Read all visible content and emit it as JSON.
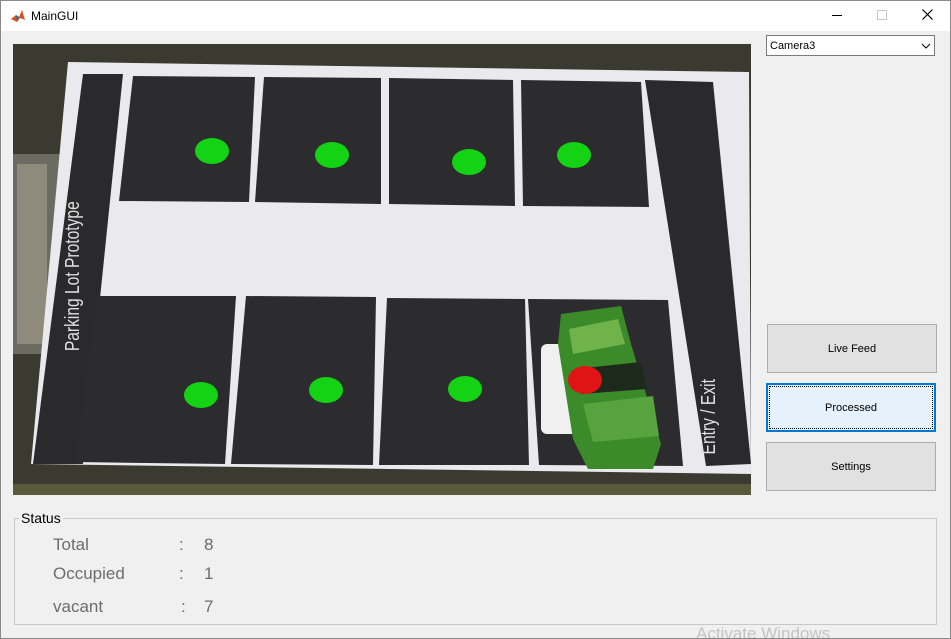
{
  "window": {
    "title": "MainGUI",
    "app_icon": "matlab-icon",
    "controls": [
      "minimize-icon",
      "maximize-icon",
      "close-icon"
    ]
  },
  "camera": {
    "selected": "Camera3"
  },
  "buttons": {
    "live_feed": "Live Feed",
    "processed": "Processed",
    "settings": "Settings"
  },
  "camera_view": {
    "board_labels": {
      "left": "Parking Lot Prototype",
      "right": "Entry / Exit"
    },
    "slot_status": {
      "top_row": [
        "vacant",
        "vacant",
        "vacant",
        "vacant"
      ],
      "bottom_row": [
        "vacant",
        "vacant",
        "vacant",
        "occupied"
      ]
    },
    "colors": {
      "vacant": "#14d214",
      "occupied": "#e01414"
    }
  },
  "status": {
    "title": "Status",
    "rows": [
      {
        "label": "Total",
        "value": "8"
      },
      {
        "label": "Occupied",
        "value": "1"
      },
      {
        "label": "vacant",
        "value": "7"
      }
    ],
    "separator": ":"
  },
  "os_watermark": "Activate Windows"
}
